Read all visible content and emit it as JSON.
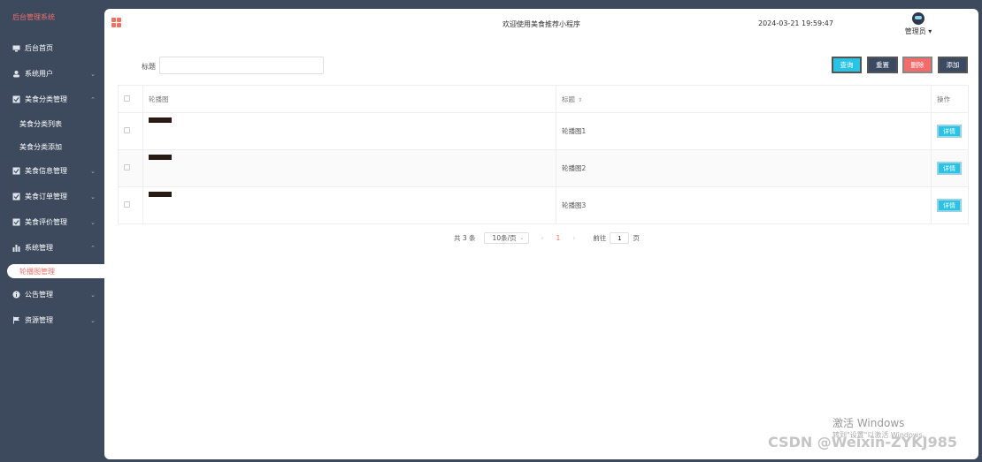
{
  "sidebar": {
    "brand": "后台管理系统",
    "items": [
      {
        "label": "后台首页",
        "icon": "monitor-icon",
        "chevron": ""
      },
      {
        "label": "系统用户",
        "icon": "user-icon",
        "chevron": "⌄"
      },
      {
        "label": "美食分类管理",
        "icon": "checkbox-icon",
        "chevron": "⌃"
      },
      {
        "label": "美食分类列表"
      },
      {
        "label": "美食分类添加"
      },
      {
        "label": "美食信息管理",
        "icon": "checkbox-icon",
        "chevron": "⌄"
      },
      {
        "label": "美食订单管理",
        "icon": "checkbox-icon",
        "chevron": "⌄"
      },
      {
        "label": "美食评价管理",
        "icon": "checkbox-icon",
        "chevron": "⌄"
      },
      {
        "label": "系统管理",
        "icon": "bar-chart-icon",
        "chevron": "⌃"
      },
      {
        "label": "轮播图管理"
      },
      {
        "label": "公告管理",
        "icon": "info-icon",
        "chevron": "⌄"
      },
      {
        "label": "资源管理",
        "icon": "flag-icon",
        "chevron": "⌄"
      }
    ]
  },
  "header": {
    "welcome": "欢迎使用美食推荐小程序",
    "datetime": "2024-03-21 19:59:47",
    "user": "管理员"
  },
  "search": {
    "label": "标题",
    "value": "",
    "placeholder": ""
  },
  "toolbar": {
    "query": "查询",
    "reset": "重置",
    "delete": "删除",
    "add": "添加"
  },
  "table": {
    "columns": [
      "",
      "轮播图",
      "标题",
      "操作"
    ],
    "rows": [
      {
        "title": "轮播图1",
        "action": "详情"
      },
      {
        "title": "轮播图2",
        "action": "详情"
      },
      {
        "title": "轮播图3",
        "action": "详情"
      }
    ]
  },
  "pagination": {
    "total": "共 3 条",
    "page_size": "10条/页",
    "prev": "‹",
    "current": "1",
    "next": "›",
    "goto_label": "前往",
    "goto_value": "1",
    "goto_unit": "页"
  },
  "watermark": {
    "activate_title": "激活 Windows",
    "activate_sub": "转到\"设置\"以激活 Windows。",
    "csdn": "CSDN @Weixin-ZYKJ985"
  },
  "colors": {
    "sidebar_bg": "#3d4a5e",
    "brand": "#f26f6a",
    "query": "#29c3e6",
    "reset": "#3b4a63",
    "delete": "#f46b6b",
    "add": "#3b4a63"
  }
}
